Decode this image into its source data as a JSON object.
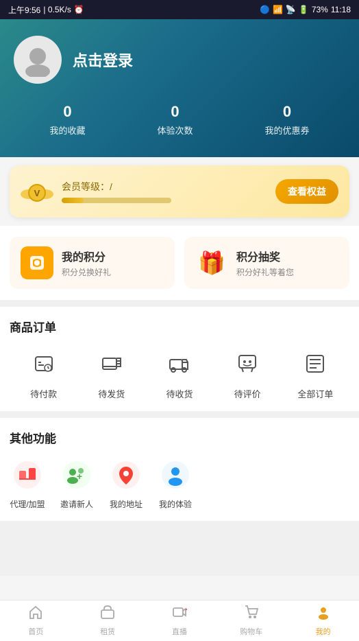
{
  "statusBar": {
    "time": "上午9:56",
    "network": "0.5K/s",
    "bluetooth": "bluetooth",
    "signal": "signal",
    "wifi": "wifi",
    "battery": "73%",
    "clockIcon": "🕐"
  },
  "hero": {
    "loginText": "点击登录",
    "stats": [
      {
        "value": "0",
        "label": "我的收藏"
      },
      {
        "value": "0",
        "label": "体验次数"
      },
      {
        "value": "0",
        "label": "我的优惠券"
      }
    ]
  },
  "memberCard": {
    "levelLabel": "会员等级：",
    "levelValue": "/",
    "btnLabel": "查看权益",
    "progress": 20
  },
  "points": {
    "myPoints": {
      "title": "我的积分",
      "sub": "积分兑换好礼"
    },
    "raffle": {
      "title": "积分抽奖",
      "sub": "积分好礼等着您"
    }
  },
  "orders": {
    "title": "商品订单",
    "items": [
      {
        "label": "待付款",
        "icon": "wallet"
      },
      {
        "label": "待发货",
        "icon": "box"
      },
      {
        "label": "待收货",
        "icon": "truck"
      },
      {
        "label": "待评价",
        "icon": "chat"
      },
      {
        "label": "全部订单",
        "icon": "list"
      }
    ]
  },
  "otherFunctions": {
    "title": "其他功能",
    "items": [
      {
        "label": "代理/加盟",
        "icon": "agent",
        "color": "#ff6b6b"
      },
      {
        "label": "邀请新人",
        "icon": "invite",
        "color": "#4caf50"
      },
      {
        "label": "我的地址",
        "icon": "location",
        "color": "#f44336"
      },
      {
        "label": "我的体验",
        "icon": "user",
        "color": "#2196f3"
      }
    ]
  },
  "bottomNav": {
    "items": [
      {
        "label": "首页",
        "icon": "home",
        "active": false
      },
      {
        "label": "租赁",
        "icon": "shop",
        "active": false
      },
      {
        "label": "直播",
        "icon": "live",
        "active": false,
        "dot": true
      },
      {
        "label": "购物车",
        "icon": "cart",
        "active": false
      },
      {
        "label": "我的",
        "icon": "profile",
        "active": true
      }
    ]
  }
}
